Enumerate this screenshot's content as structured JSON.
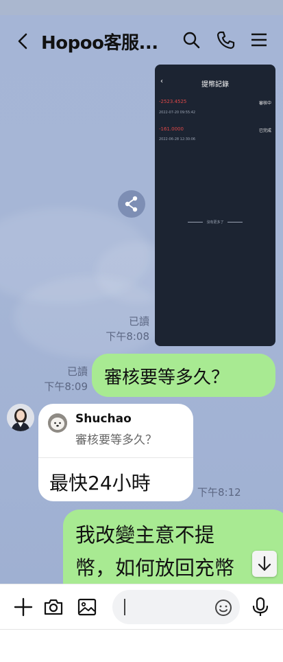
{
  "header": {
    "title": "Hopoo客服...",
    "back_icon": "chevron-left-icon",
    "actions": [
      "search-icon",
      "phone-icon",
      "menu-icon"
    ]
  },
  "shared_screenshot": {
    "title": "提幣記錄",
    "records": [
      {
        "amount": "-2523.4525",
        "status": "審核中",
        "date": "2022-07-20 09:55:42"
      },
      {
        "amount": "-161.0000",
        "status": "已完成",
        "date": "2022-06-28 12:30:06"
      }
    ],
    "end_text": "沒有更多了"
  },
  "messages": {
    "image_read": "已讀",
    "image_time": "下午8:08",
    "q_read": "已讀",
    "q_time": "下午8:09",
    "q_text": "審核要等多久？",
    "reply_name": "Shuchao",
    "reply_quote": "審核要等多久？",
    "reply_text": "最快24小時",
    "reply_time": "下午8:12",
    "last_line1": "我改變主意不提",
    "last_line2": "幣，如何放回充幣"
  },
  "input": {
    "placeholder": "",
    "icons": [
      "plus-icon",
      "camera-icon",
      "image-icon",
      "emoji-icon",
      "microphone-icon"
    ]
  },
  "colors": {
    "chat_background": "#a6b6d6",
    "my_bubble": "#a8ea92",
    "their_bubble": "#ffffff",
    "amount_red": "#e04848"
  }
}
